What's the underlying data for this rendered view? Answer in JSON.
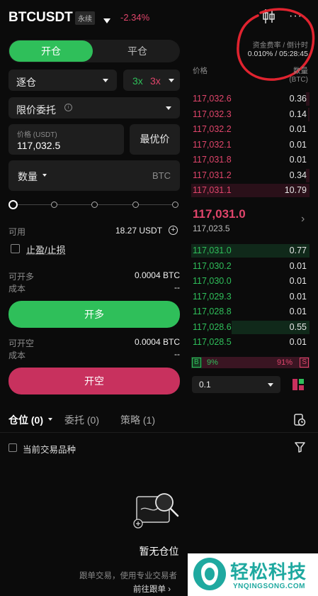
{
  "header": {
    "symbol": "BTCUSDT",
    "contract_badge": "永续",
    "change_pct": "-2.34%",
    "change_color": "#e0456b"
  },
  "funding": {
    "label": "资金费率 / 倒计时",
    "value": "0.010% / 05:28:45"
  },
  "trade_tabs": {
    "open": "开仓",
    "close": "平仓",
    "active": "open"
  },
  "margin_mode": {
    "value": "逐仓"
  },
  "leverage": {
    "long": "3x",
    "short": "3x"
  },
  "order_type": {
    "value": "限价委托"
  },
  "price_input": {
    "label": "价格 (USDT)",
    "value": "117,032.5"
  },
  "best_price_button": "最优价",
  "quantity": {
    "label": "数量",
    "unit": "BTC"
  },
  "slider": {
    "percent": 0
  },
  "available": {
    "label": "可用",
    "value": "18.27 USDT"
  },
  "tpsl": {
    "label": "止盈/止损"
  },
  "long_section": {
    "can_open_label": "可开多",
    "can_open_value": "0.0004 BTC",
    "cost_label": "成本",
    "cost_value": "--",
    "button": "开多"
  },
  "short_section": {
    "can_open_label": "可开空",
    "can_open_value": "0.0004 BTC",
    "cost_label": "成本",
    "cost_value": "--",
    "button": "开空"
  },
  "orderbook": {
    "price_header": "价格",
    "qty_header": "数量",
    "qty_unit": "(BTC)",
    "asks": [
      {
        "price": "117,032.6",
        "qty": "0.36",
        "depth": 0.03
      },
      {
        "price": "117,032.3",
        "qty": "0.14",
        "depth": 0.01
      },
      {
        "price": "117,032.2",
        "qty": "0.01",
        "depth": 0.0
      },
      {
        "price": "117,032.1",
        "qty": "0.01",
        "depth": 0.0
      },
      {
        "price": "117,031.8",
        "qty": "0.01",
        "depth": 0.0
      },
      {
        "price": "117,031.2",
        "qty": "0.34",
        "depth": 0.03
      },
      {
        "price": "117,031.1",
        "qty": "10.79",
        "depth": 1.0
      }
    ],
    "last_price": "117,031.0",
    "mark_price": "117,023.5",
    "bids": [
      {
        "price": "117,031.0",
        "qty": "0.77",
        "depth": 1.0
      },
      {
        "price": "117,030.2",
        "qty": "0.01",
        "depth": 0.0
      },
      {
        "price": "117,030.0",
        "qty": "0.01",
        "depth": 0.0
      },
      {
        "price": "117,029.3",
        "qty": "0.01",
        "depth": 0.0
      },
      {
        "price": "117,028.8",
        "qty": "0.01",
        "depth": 0.0
      },
      {
        "price": "117,028.6",
        "qty": "0.55",
        "depth": 0.66
      },
      {
        "price": "117,028.5",
        "qty": "0.01",
        "depth": 0.0
      }
    ],
    "buy_ratio_label": "B",
    "buy_ratio": "9%",
    "sell_ratio": "91%",
    "sell_ratio_label": "S",
    "buy_fraction": 0.09,
    "precision": "0.1"
  },
  "bottom_tabs": {
    "positions": "仓位 (0)",
    "orders": "委托 (0)",
    "strategies": "策略 (1)"
  },
  "current_symbol_filter": "当前交易品种",
  "empty": {
    "title": "暂无仓位",
    "desc": "跟单交易，使用专业交易者",
    "link": "前往跟单 ›"
  },
  "watermark": {
    "text": "轻松科技",
    "sub": "YNQINGSONG.COM"
  },
  "colors": {
    "green": "#2fbf5a",
    "red": "#e0456b",
    "short_button": "#c8315e",
    "annotation": "#e0232f"
  }
}
